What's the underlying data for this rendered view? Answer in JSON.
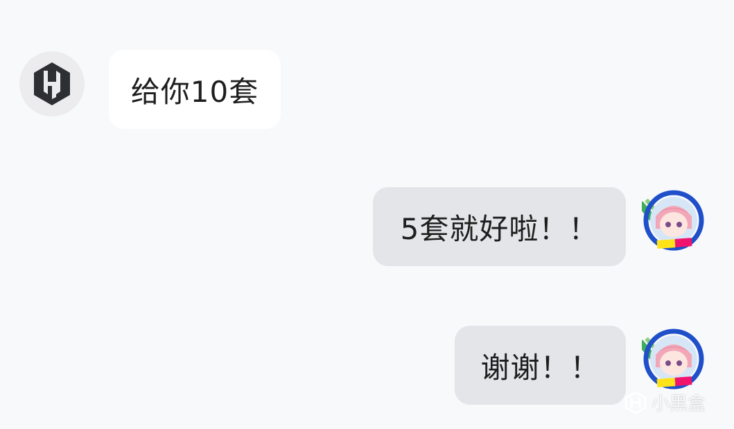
{
  "messages": [
    {
      "sender": "bot",
      "text": "给你10套"
    },
    {
      "sender": "user",
      "text": "5套就好啦！！"
    },
    {
      "sender": "user",
      "text": "谢谢！！"
    }
  ],
  "avatars": {
    "bot": "hexagon-logo-icon",
    "user": "anime-girl-avatar"
  },
  "watermark": {
    "text": "小黑盒"
  },
  "colors": {
    "background": "#f8f9fb",
    "incoming_bubble": "#ffffff",
    "outgoing_bubble": "#e4e5e8",
    "text": "#1e1e1e"
  }
}
